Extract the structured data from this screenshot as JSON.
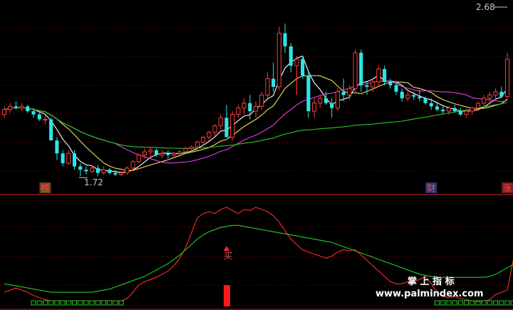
{
  "chart_data": [
    {
      "type": "candlestick",
      "panel": "price",
      "ylim": [
        1.6,
        2.75
      ],
      "annotations": {
        "max_label": "2.68",
        "min_label": "1.72"
      },
      "markers": [
        {
          "text": "榜",
          "color": "#ff4d4d",
          "bg": "#6b4a20",
          "index": 7
        },
        {
          "text": "财",
          "color": "#ff4d4d",
          "bg": "#203870",
          "index": 73
        },
        {
          "text": "涨",
          "color": "#ff4d4d",
          "bg": "#6b2020",
          "index": 86
        }
      ],
      "candles": [
        [
          2.08,
          2.13,
          2.06,
          2.11
        ],
        [
          2.11,
          2.15,
          2.09,
          2.13
        ],
        [
          2.13,
          2.16,
          2.11,
          2.12
        ],
        [
          2.12,
          2.15,
          2.1,
          2.13
        ],
        [
          2.13,
          2.14,
          2.09,
          2.1
        ],
        [
          2.1,
          2.12,
          2.06,
          2.08
        ],
        [
          2.08,
          2.1,
          2.04,
          2.05
        ],
        [
          2.05,
          2.08,
          2.02,
          2.05
        ],
        [
          2.05,
          2.06,
          1.95,
          1.92
        ],
        [
          1.92,
          1.94,
          1.8,
          1.84
        ],
        [
          1.84,
          1.86,
          1.76,
          1.78
        ],
        [
          1.78,
          1.86,
          1.77,
          1.84
        ],
        [
          1.84,
          1.86,
          1.74,
          1.76
        ],
        [
          1.76,
          1.78,
          1.7,
          1.74
        ],
        [
          1.74,
          1.76,
          1.71,
          1.73
        ],
        [
          1.73,
          1.77,
          1.72,
          1.75
        ],
        [
          1.75,
          1.77,
          1.7,
          1.72
        ],
        [
          1.72,
          1.76,
          1.71,
          1.74
        ],
        [
          1.74,
          1.75,
          1.71,
          1.72
        ],
        [
          1.72,
          1.74,
          1.7,
          1.71
        ],
        [
          1.71,
          1.73,
          1.7,
          1.72
        ],
        [
          1.72,
          1.76,
          1.71,
          1.75
        ],
        [
          1.75,
          1.8,
          1.74,
          1.79
        ],
        [
          1.79,
          1.84,
          1.78,
          1.83
        ],
        [
          1.83,
          1.87,
          1.81,
          1.85
        ],
        [
          1.85,
          1.88,
          1.82,
          1.86
        ],
        [
          1.86,
          1.87,
          1.82,
          1.83
        ],
        [
          1.83,
          1.86,
          1.81,
          1.84
        ],
        [
          1.84,
          1.86,
          1.81,
          1.83
        ],
        [
          1.83,
          1.85,
          1.81,
          1.84
        ],
        [
          1.84,
          1.86,
          1.82,
          1.85
        ],
        [
          1.85,
          1.88,
          1.84,
          1.87
        ],
        [
          1.87,
          1.89,
          1.85,
          1.88
        ],
        [
          1.88,
          1.92,
          1.86,
          1.91
        ],
        [
          1.91,
          1.95,
          1.89,
          1.94
        ],
        [
          1.94,
          1.98,
          1.92,
          1.97
        ],
        [
          1.97,
          2.02,
          1.95,
          2.01
        ],
        [
          2.01,
          2.08,
          1.99,
          2.06
        ],
        [
          2.06,
          2.14,
          2.04,
          1.94
        ],
        [
          1.94,
          2.1,
          1.92,
          2.08
        ],
        [
          2.08,
          2.14,
          2.06,
          2.12
        ],
        [
          2.12,
          2.18,
          2.08,
          2.15
        ],
        [
          2.15,
          2.2,
          2.05,
          2.1
        ],
        [
          2.1,
          2.16,
          2.06,
          2.13
        ],
        [
          2.13,
          2.22,
          2.11,
          2.2
        ],
        [
          2.2,
          2.34,
          2.18,
          2.3
        ],
        [
          2.3,
          2.4,
          2.22,
          2.25
        ],
        [
          2.25,
          2.62,
          2.23,
          2.58
        ],
        [
          2.58,
          2.64,
          2.46,
          2.5
        ],
        [
          2.5,
          2.52,
          2.34,
          2.38
        ],
        [
          2.38,
          2.44,
          2.2,
          2.42
        ],
        [
          2.42,
          2.44,
          2.3,
          2.32
        ],
        [
          2.32,
          2.34,
          2.06,
          2.1
        ],
        [
          2.1,
          2.18,
          2.06,
          2.15
        ],
        [
          2.15,
          2.2,
          2.12,
          2.18
        ],
        [
          2.18,
          2.22,
          2.14,
          2.15
        ],
        [
          2.15,
          2.18,
          2.06,
          2.12
        ],
        [
          2.12,
          2.24,
          2.1,
          2.22
        ],
        [
          2.22,
          2.3,
          2.16,
          2.2
        ],
        [
          2.2,
          2.26,
          2.17,
          2.24
        ],
        [
          2.24,
          2.48,
          2.22,
          2.46
        ],
        [
          2.46,
          2.48,
          2.22,
          2.26
        ],
        [
          2.26,
          2.28,
          2.2,
          2.25
        ],
        [
          2.25,
          2.3,
          2.22,
          2.28
        ],
        [
          2.28,
          2.38,
          2.25,
          2.36
        ],
        [
          2.36,
          2.38,
          2.26,
          2.28
        ],
        [
          2.28,
          2.3,
          2.24,
          2.26
        ],
        [
          2.26,
          2.28,
          2.2,
          2.22
        ],
        [
          2.22,
          2.24,
          2.16,
          2.18
        ],
        [
          2.18,
          2.22,
          2.16,
          2.2
        ],
        [
          2.2,
          2.22,
          2.17,
          2.19
        ],
        [
          2.19,
          2.23,
          2.16,
          2.18
        ],
        [
          2.18,
          2.19,
          2.14,
          2.15
        ],
        [
          2.15,
          2.18,
          2.11,
          2.13
        ],
        [
          2.13,
          2.16,
          2.1,
          2.11
        ],
        [
          2.11,
          2.13,
          2.08,
          2.1
        ],
        [
          2.1,
          2.13,
          2.08,
          2.12
        ],
        [
          2.12,
          2.14,
          2.09,
          2.1
        ],
        [
          2.1,
          2.12,
          2.07,
          2.08
        ],
        [
          2.08,
          2.11,
          2.06,
          2.1
        ],
        [
          2.1,
          2.13,
          2.08,
          2.12
        ],
        [
          2.12,
          2.16,
          2.1,
          2.15
        ],
        [
          2.15,
          2.2,
          2.13,
          2.18
        ],
        [
          2.18,
          2.22,
          2.15,
          2.2
        ],
        [
          2.2,
          2.24,
          2.17,
          2.22
        ],
        [
          2.22,
          2.25,
          2.18,
          2.19
        ],
        [
          2.19,
          2.46,
          2.18,
          2.42
        ]
      ]
    },
    {
      "type": "line",
      "panel": "indicator",
      "ylim": [
        0,
        100
      ],
      "signal_text": "买",
      "signal_index": 38,
      "series": [
        {
          "color": "#ff2a2a",
          "values": [
            10,
            12,
            14,
            12,
            10,
            7,
            5,
            3,
            2,
            2,
            2,
            2,
            2,
            2,
            2,
            2,
            2,
            2,
            2,
            2,
            2,
            4,
            10,
            17,
            20,
            22,
            24,
            27,
            30,
            35,
            42,
            52,
            66,
            80,
            84,
            86,
            84,
            88,
            90,
            87,
            84,
            88,
            87,
            90,
            88,
            86,
            82,
            76,
            68,
            60,
            55,
            50,
            48,
            46,
            44,
            42,
            44,
            48,
            50,
            49,
            50,
            45,
            40,
            35,
            30,
            25,
            20,
            18,
            18,
            20,
            20,
            22,
            25,
            18,
            10,
            6,
            5,
            6,
            4,
            3,
            2,
            1,
            2,
            3,
            8,
            10,
            12,
            40
          ]
        },
        {
          "color": "#22cc22",
          "values": [
            18,
            17,
            16,
            15,
            14,
            13,
            12,
            11,
            10,
            10,
            10,
            10,
            10,
            10,
            10,
            10,
            11,
            12,
            13,
            15,
            17,
            19,
            21,
            23,
            25,
            28,
            31,
            34,
            37,
            41,
            45,
            50,
            55,
            60,
            64,
            67,
            69,
            71,
            72,
            73,
            73,
            72,
            71,
            70,
            69,
            68,
            67,
            66,
            65,
            64,
            63,
            62,
            61,
            60,
            59,
            58,
            57,
            55,
            53,
            51,
            49,
            47,
            45,
            43,
            41,
            39,
            37,
            35,
            33,
            31,
            29,
            27,
            26,
            25,
            24,
            24,
            24,
            24,
            24,
            24,
            24,
            24,
            24,
            25,
            27,
            30,
            33,
            36
          ]
        }
      ]
    }
  ],
  "watermark": {
    "line1": "掌 上 指 标",
    "line2": "www.palmindex.com"
  },
  "colors": {
    "up": "#ff3b3b",
    "down": "#2ee6e6",
    "ma5": "#ffffff",
    "ma10": "#f0e060",
    "ma20": "#e040e0",
    "ma60": "#22cc22",
    "grid": "#6b0000",
    "axis": "#b02020"
  }
}
